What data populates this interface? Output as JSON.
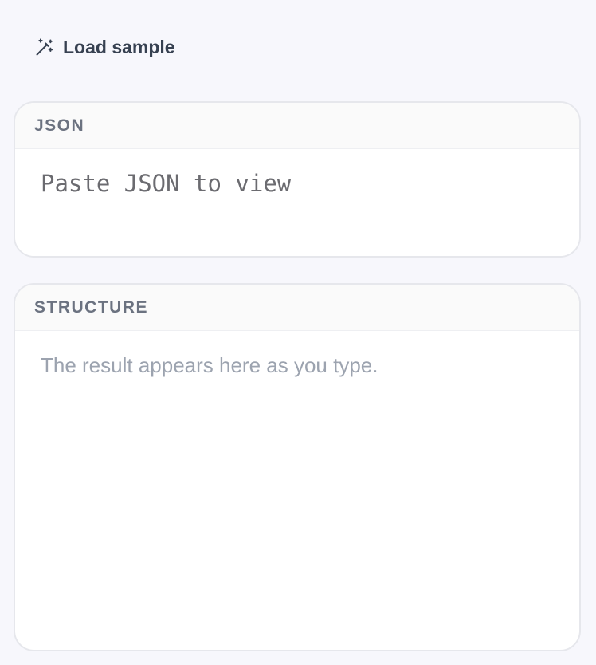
{
  "toolbar": {
    "load_sample_label": "Load sample",
    "load_sample_icon": "magic-wand-icon"
  },
  "json_panel": {
    "title": "JSON",
    "input_value": "",
    "input_placeholder": "Paste JSON to view"
  },
  "structure_panel": {
    "title": "STRUCTURE",
    "placeholder": "The result appears here as you type."
  },
  "colors": {
    "page_background": "#f7f7fc",
    "panel_background": "#ffffff",
    "panel_border": "#e6e7ec",
    "header_text": "#6b7280",
    "body_text": "#374151",
    "muted_text": "#9ca3af"
  }
}
